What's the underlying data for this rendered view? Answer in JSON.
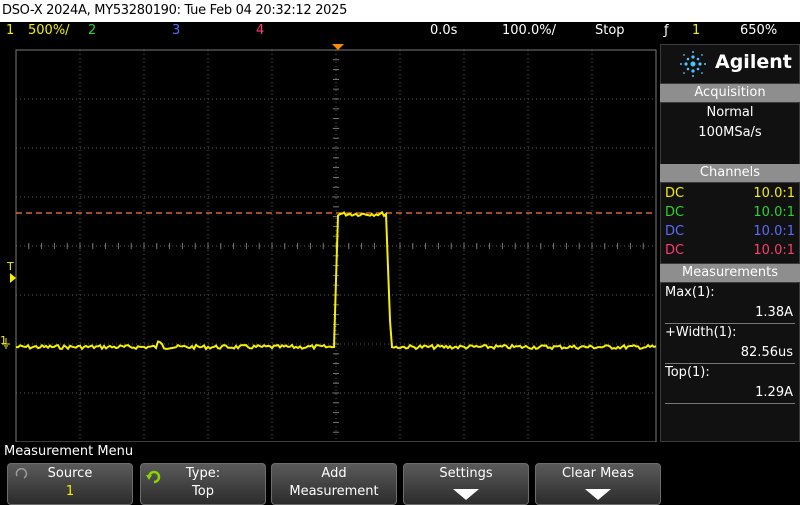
{
  "titlebar": {
    "text": "DSO-X 2024A, MY53280190: Tue Feb 04 20:32:12 2025"
  },
  "status": {
    "ch1_num": "1",
    "ch1_scale": "500%/",
    "ch2_num": "2",
    "ch3_num": "3",
    "ch4_num": "4",
    "time_delay": "0.0s",
    "time_scale": "100.0%/",
    "run_state": "Stop",
    "trigger_symbol": "ƒ",
    "trigger_channel": "1",
    "trigger_level": "650%"
  },
  "colors": {
    "ch1": "#f5ef00",
    "ch2": "#2bd42b",
    "ch3": "#5a6cff",
    "ch4": "#ff3c6e",
    "trigger_marker": "#ff8a00",
    "cursor_line": "#ff7a3c"
  },
  "screen": {
    "trigger_level_marker": "T",
    "ground_marker": "1"
  },
  "sidepanel": {
    "brand": "Agilent",
    "acquisition": {
      "title": "Acquisition",
      "mode": "Normal",
      "rate": "100MSa/s"
    },
    "channels": {
      "title": "Channels",
      "rows": [
        {
          "coupling": "DC",
          "probe": "10.0:1",
          "color": "#f5ef00"
        },
        {
          "coupling": "DC",
          "probe": "10.0:1",
          "color": "#2bd42b"
        },
        {
          "coupling": "DC",
          "probe": "10.0:1",
          "color": "#5a6cff"
        },
        {
          "coupling": "DC",
          "probe": "10.0:1",
          "color": "#ff3c6e"
        }
      ]
    },
    "measurements": {
      "title": "Measurements",
      "items": [
        {
          "name": "Max(1):",
          "value": "1.38A"
        },
        {
          "name": "+Width(1):",
          "value": "82.56us"
        },
        {
          "name": "Top(1):",
          "value": "1.29A"
        }
      ]
    }
  },
  "menu": {
    "title": "Measurement Menu",
    "softkeys": [
      {
        "line1": "Source",
        "line2": "1"
      },
      {
        "line1": "Type:",
        "line2": "Top"
      },
      {
        "line1": "Add",
        "line2": "Measurement"
      },
      {
        "line1": "Settings",
        "line2": ""
      },
      {
        "line1": "Clear Meas",
        "line2": ""
      }
    ]
  }
}
